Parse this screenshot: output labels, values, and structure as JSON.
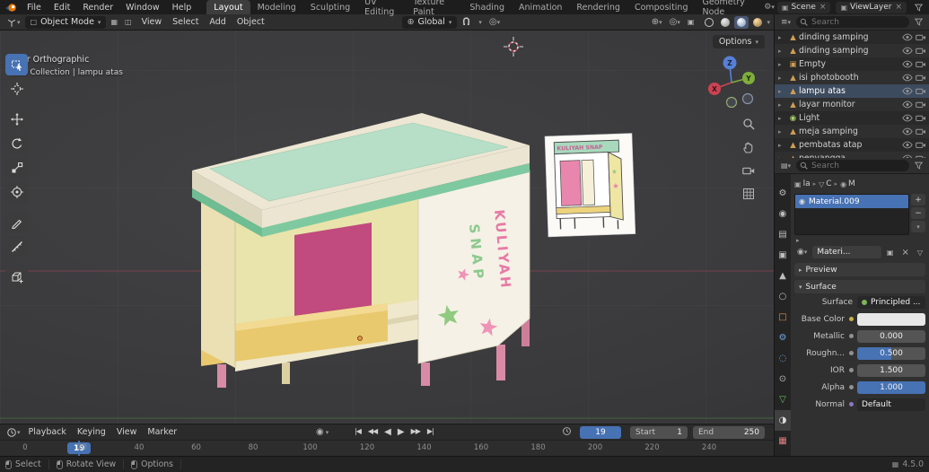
{
  "topbar": {
    "menus": [
      "File",
      "Edit",
      "Render",
      "Window",
      "Help"
    ],
    "workspaces": [
      "Layout",
      "Modeling",
      "Sculpting",
      "UV Editing",
      "Texture Paint",
      "Shading",
      "Animation",
      "Rendering",
      "Compositing",
      "Geometry Node"
    ],
    "active_workspace": "Layout",
    "scene_label": "Scene",
    "viewlayer_label": "ViewLayer"
  },
  "viewport_header": {
    "mode": "Object Mode",
    "menus": [
      "View",
      "Select",
      "Add",
      "Object"
    ],
    "orientation": "Global",
    "options_label": "Options"
  },
  "viewport": {
    "overlay_line1": "User Orthographic",
    "overlay_line2": "(19) Collection | lampu atas",
    "axis_x": "X",
    "axis_y": "Y",
    "axis_z": "Z",
    "sign_word1": "KULIYAH",
    "sign_word2": "SNAP",
    "ref_sign": "KULIYAH SNAP"
  },
  "toolbar_tools": [
    "select-box",
    "cursor",
    "move",
    "rotate",
    "scale",
    "transform",
    "annotate",
    "measure",
    "add-cube"
  ],
  "outliner": {
    "search_placeholder": "Search",
    "items": [
      {
        "label": "dinding samping",
        "icon": "mesh-object-icon"
      },
      {
        "label": "dinding samping",
        "icon": "mesh-object-icon"
      },
      {
        "label": "Empty",
        "icon": "empty-image-icon"
      },
      {
        "label": "isi photobooth",
        "icon": "mesh-object-icon"
      },
      {
        "label": "lampu atas",
        "icon": "mesh-object-icon",
        "active": true
      },
      {
        "label": "layar monitor",
        "icon": "mesh-object-icon"
      },
      {
        "label": "Light",
        "icon": "light-object-icon"
      },
      {
        "label": "meja samping",
        "icon": "mesh-object-icon"
      },
      {
        "label": "pembatas atap",
        "icon": "mesh-object-icon"
      },
      {
        "label": "penyangga",
        "icon": "mesh-object-icon"
      }
    ]
  },
  "properties": {
    "search_placeholder": "Search",
    "breadcrumb": [
      {
        "icon": "object-icon",
        "label": "la"
      },
      {
        "icon": "mesh-data-icon",
        "label": "C"
      },
      {
        "icon": "material-icon",
        "label": "M"
      }
    ],
    "tabs": [
      "tool-tab-icon",
      "render-tab-icon",
      "output-tab-icon",
      "viewlayer-tab-icon",
      "scene-tab-icon",
      "world-tab-icon",
      "object-tab-icon",
      "modifier-tab-icon",
      "physics-tab-icon",
      "constraints-tab-icon",
      "data-tab-icon",
      "material-tab-icon",
      "texture-tab-icon"
    ],
    "active_tab": "material-tab-icon",
    "slots": [
      {
        "name": "Material.009",
        "selected": true
      }
    ],
    "material_field": "Materi...",
    "preview_section": "Preview",
    "surface_section": "Surface",
    "rows": {
      "sur4face_note": "",
      "surface_label": "Surface",
      "surface_value": "Principled ...",
      "base_color_label": "Base Color",
      "metallic_label": "Metallic",
      "metallic_value": "0.000",
      "roughness_label": "Roughn...",
      "roughness_value": "0.500",
      "ior_label": "IOR",
      "ior_value": "1.500",
      "alpha_label": "Alpha",
      "alpha_value": "1.000",
      "normal_label": "Normal",
      "normal_value": "Default"
    }
  },
  "timeline": {
    "menus": [
      "Playback",
      "Keying",
      "View",
      "Marker"
    ],
    "ticks": [
      0,
      20,
      40,
      60,
      80,
      100,
      120,
      140,
      160,
      180,
      200,
      220,
      240
    ],
    "current_frame": 19,
    "frame_display": "19",
    "start_label": "Start",
    "start_value": "1",
    "end_label": "End",
    "end_value": "250"
  },
  "statusbar": {
    "items": [
      "Select",
      "Rotate View",
      "Options"
    ],
    "version": "4.5.0"
  },
  "colors": {
    "accent": "#4772b3",
    "selected_slot": "#4772b3",
    "axis_x_red": "#b4465a",
    "axis_y_green": "#5a9646"
  }
}
